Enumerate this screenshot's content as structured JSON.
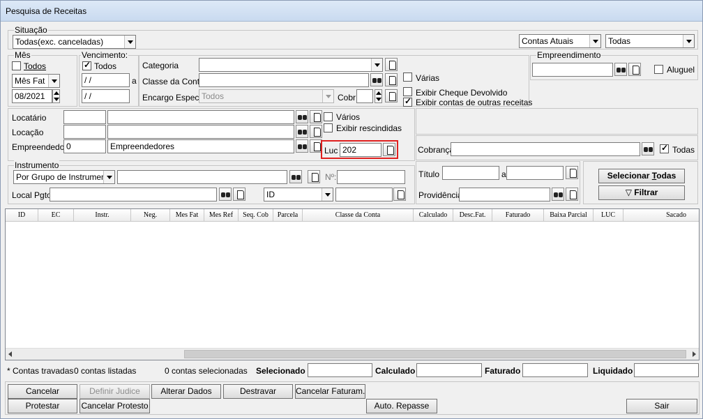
{
  "window": {
    "title": "Pesquisa de Receitas"
  },
  "situacao": {
    "legend": "Situação",
    "status_value": "Todas(exc. canceladas)",
    "accounts_value": "Contas Atuais",
    "filter_value": "Todas"
  },
  "mes": {
    "legend": "Mês",
    "todos_label": "Todos",
    "todos_checked": false,
    "type_value": "Mês Fat",
    "month_value": "08/2021"
  },
  "vencimento": {
    "legend": "Vencimento:",
    "todos_label": "Todos",
    "todos_checked": true,
    "from_value": " / /",
    "sep_label": "a",
    "to_value": " / /"
  },
  "categoria": {
    "categoria_label": "Categoria",
    "categoria_value": "",
    "classe_label": "Classe da Conta",
    "classe_value": "",
    "encargo_label": "Encargo Espec.",
    "encargo_value": "Todos",
    "cobr_label": "Cobr",
    "cobr_value": "",
    "varias_label": "Várias",
    "varias_checked": false,
    "cheque_label": "Exibir Cheque Devolvido",
    "cheque_checked": false,
    "outras_label": "Exibir contas de outras receitas",
    "outras_checked": true
  },
  "empreendimento": {
    "legend": "Empreendimento",
    "value": "",
    "aluguel_label": "Aluguel",
    "aluguel_checked": false
  },
  "locacao": {
    "locatario_label": "Locatário",
    "locatario_code": "",
    "locatario_name": "",
    "locacao_label": "Locação",
    "locacao_code": "",
    "locacao_name": "",
    "empreendedor_label": "Empreendedor",
    "empreendedor_code": "0",
    "empreendedor_name": "Empreendedores",
    "varios_label": "Vários",
    "varios_checked": false,
    "rescindidas_label": "Exibir rescindidas",
    "rescindidas_checked": false,
    "luc_label": "Luc",
    "luc_value": "202"
  },
  "cobranca": {
    "label": "Cobrança",
    "value": "",
    "todas_label": "Todas",
    "todas_checked": true
  },
  "instrumento": {
    "legend": "Instrumento",
    "group_value": "Por Grupo de Instrumento",
    "value": "",
    "numero_label": "Nº:",
    "numero_value": "",
    "local_label": "Local Pgto",
    "local_value": "",
    "order_value": "ID",
    "order_text": ""
  },
  "titulo": {
    "titulo_label": "Título",
    "titulo_from": "",
    "sep_label": "a",
    "titulo_to": "",
    "providencia_label": "Providência",
    "providencia_value": ""
  },
  "actions": {
    "select_all_prefix": "Selecionar ",
    "select_all_mn": "T",
    "select_all_rest": "odas",
    "filter_label": "Filtrar"
  },
  "grid": {
    "columns": [
      "ID",
      "EC",
      "Instr.",
      "Neg.",
      "Mes Fat",
      "Mes Ref",
      "Seq. Cob",
      "Parcela",
      "Classe da Conta",
      "Calculado",
      "Desc.Fat.",
      "Faturado",
      "Baixa Parcial",
      "LUC",
      "Sacado"
    ]
  },
  "summary": {
    "locked_note": "* Contas travadas",
    "listed": "0 contas listadas",
    "selected_count": "0 contas selecionadas",
    "selecionado_label": "Selecionado",
    "selecionado_value": "",
    "calculado_label": "Calculado",
    "calculado_value": "",
    "faturado_label": "Faturado",
    "faturado_value": "",
    "liquidado_label": "Liquidado",
    "liquidado_value": ""
  },
  "buttons": {
    "cancelar": "Cancelar",
    "definir_judice": "Definir Judice",
    "alterar_dados": "Alterar Dados",
    "destravar": "Destravar",
    "cancelar_faturam": "Cancelar Faturam.",
    "protestar": "Protestar",
    "cancelar_protesto": "Cancelar Protesto",
    "auto_repasse": "Auto. Repasse",
    "sair": "Sair"
  }
}
